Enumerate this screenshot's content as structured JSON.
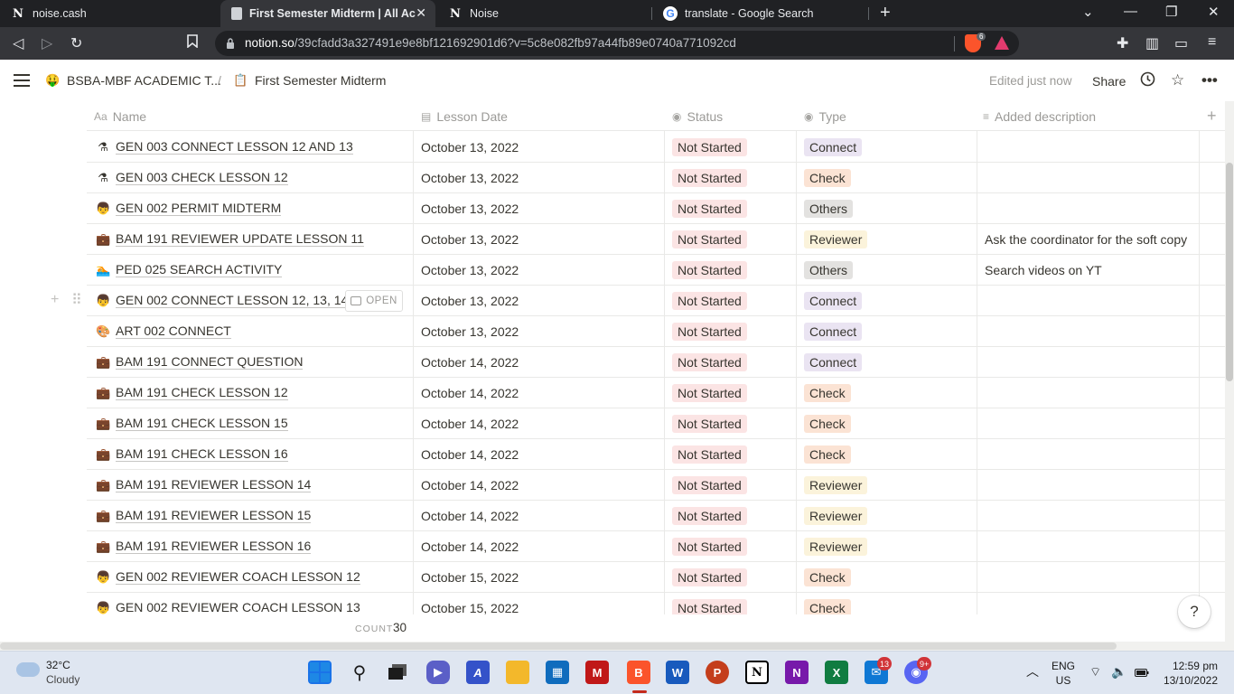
{
  "browser": {
    "tabs": [
      {
        "title": "noise.cash",
        "favicon": "notion-icon",
        "active": false
      },
      {
        "title": "First Semester Midterm | All Acad",
        "favicon": "page-icon",
        "active": true
      },
      {
        "title": "Noise",
        "favicon": "notion-icon",
        "active": false
      },
      {
        "title": "translate - Google Search",
        "favicon": "google-icon",
        "active": false
      }
    ],
    "new_tab_label": "+",
    "url_host": "notion.so",
    "url_path": "/39cfadd3a327491e9e8bf121692901d6?v=5c8e082fb97a44fb89e0740a771092cd",
    "brave_shield_count": "6"
  },
  "notion": {
    "breadcrumb": [
      {
        "icon": "🤑",
        "label": "BSBA-MBF ACADEMIC T..."
      },
      {
        "icon": "📋",
        "label": "First Semester Midterm"
      }
    ],
    "separator": "/",
    "edited": "Edited just now",
    "share_label": "Share",
    "columns": {
      "name": "Name",
      "date": "Lesson Date",
      "status": "Status",
      "type": "Type",
      "description": "Added description"
    },
    "open_label": "OPEN",
    "rows": [
      {
        "icon": "⚗",
        "name": "GEN 003 CONNECT LESSON 12 AND 13",
        "date": "October 13, 2022",
        "status": "Not Started",
        "type": "Connect",
        "desc": ""
      },
      {
        "icon": "⚗",
        "name": "GEN 003 CHECK LESSON 12",
        "date": "October 13, 2022",
        "status": "Not Started",
        "type": "Check",
        "desc": ""
      },
      {
        "icon": "👦",
        "name": "GEN 002 PERMIT MIDTERM",
        "date": "October 13, 2022",
        "status": "Not Started",
        "type": "Others",
        "desc": ""
      },
      {
        "icon": "💼",
        "name": "BAM 191 REVIEWER UPDATE LESSON 11",
        "date": "October 13, 2022",
        "status": "Not Started",
        "type": "Reviewer",
        "desc": "Ask the coordinator for the soft copy"
      },
      {
        "icon": "🏊",
        "name": "PED 025 SEARCH ACTIVITY",
        "date": "October 13, 2022",
        "status": "Not Started",
        "type": "Others",
        "desc": "Search videos on YT"
      },
      {
        "icon": "👦",
        "name": "GEN 002 CONNECT LESSON 12, 13, 14",
        "date": "October 13, 2022",
        "status": "Not Started",
        "type": "Connect",
        "desc": "",
        "hover": true
      },
      {
        "icon": "🎨",
        "name": "ART 002 CONNECT",
        "date": "October 13, 2022",
        "status": "Not Started",
        "type": "Connect",
        "desc": ""
      },
      {
        "icon": "💼",
        "name": "BAM 191 CONNECT QUESTION",
        "date": "October 14, 2022",
        "status": "Not Started",
        "type": "Connect",
        "desc": ""
      },
      {
        "icon": "💼",
        "name": "BAM 191 CHECK LESSON 12",
        "date": "October 14, 2022",
        "status": "Not Started",
        "type": "Check",
        "desc": ""
      },
      {
        "icon": "💼",
        "name": "BAM 191 CHECK LESSON 15",
        "date": "October 14, 2022",
        "status": "Not Started",
        "type": "Check",
        "desc": ""
      },
      {
        "icon": "💼",
        "name": "BAM 191 CHECK LESSON 16",
        "date": "October 14, 2022",
        "status": "Not Started",
        "type": "Check",
        "desc": ""
      },
      {
        "icon": "💼",
        "name": "BAM 191 REVIEWER LESSON 14",
        "date": "October 14, 2022",
        "status": "Not Started",
        "type": "Reviewer",
        "desc": ""
      },
      {
        "icon": "💼",
        "name": "BAM 191 REVIEWER LESSON 15",
        "date": "October 14, 2022",
        "status": "Not Started",
        "type": "Reviewer",
        "desc": ""
      },
      {
        "icon": "💼",
        "name": "BAM 191 REVIEWER LESSON 16",
        "date": "October 14, 2022",
        "status": "Not Started",
        "type": "Reviewer",
        "desc": ""
      },
      {
        "icon": "👦",
        "name": "GEN 002 REVIEWER COACH LESSON 12",
        "date": "October 15, 2022",
        "status": "Not Started",
        "type": "Check",
        "desc": ""
      },
      {
        "icon": "👦",
        "name": "GEN 002 REVIEWER COACH LESSON 13",
        "date": "October 15, 2022",
        "status": "Not Started",
        "type": "Check",
        "desc": ""
      }
    ],
    "count_label": "COUNT",
    "count_value": "30",
    "help_label": "?"
  },
  "taskbar": {
    "temperature": "32°C",
    "condition": "Cloudy",
    "apps": [
      "start-icon",
      "search-icon",
      "task-view-icon",
      "teams-chat-icon",
      "vscode-like-icon",
      "file-explorer-icon",
      "store-icon",
      "mcafee-icon",
      "brave-icon",
      "word-icon",
      "powerpoint-icon",
      "notion-icon",
      "onenote-icon",
      "excel-icon",
      "mail-icon",
      "discord-icon"
    ],
    "badge_mail": "13",
    "badge_discord": "9+",
    "language": "ENG",
    "region": "US",
    "time": "12:59 pm",
    "date": "13/10/2022"
  },
  "colors": {
    "status_not_started": "#fbe4e4",
    "type_connect": "#eae4f2",
    "type_check": "#fbe3d4",
    "type_others": "#e3e2e0",
    "type_reviewer": "#fbf3db"
  }
}
